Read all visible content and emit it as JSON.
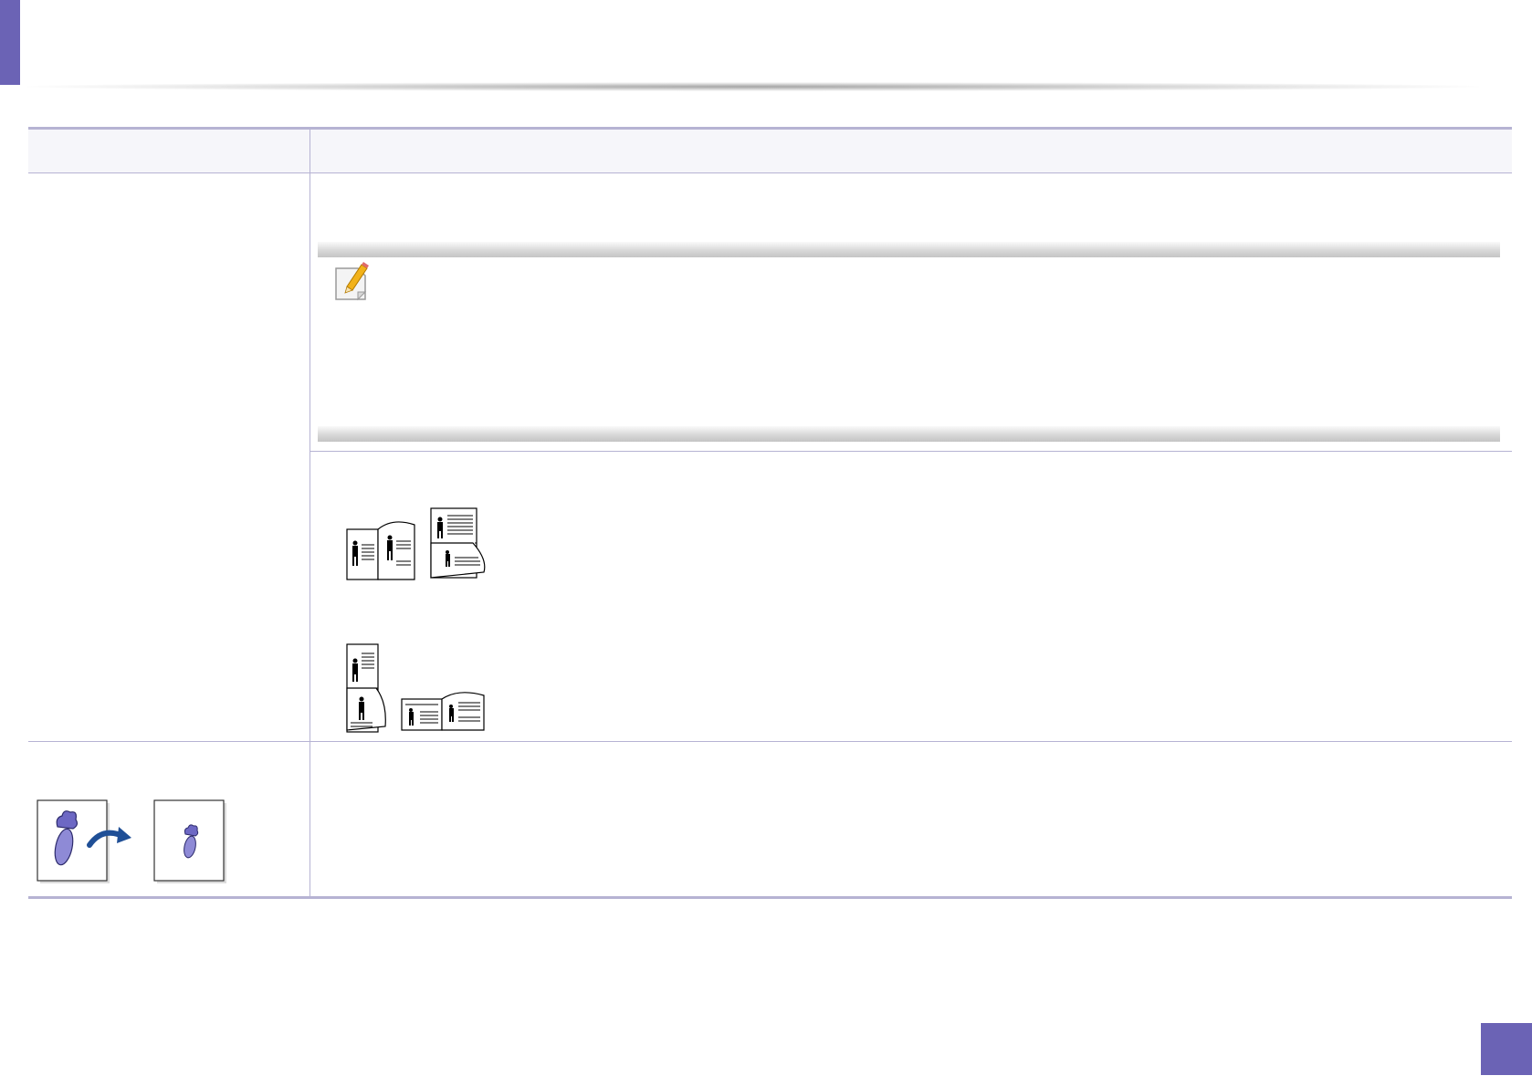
{
  "page": {
    "accent_color": "#6b63b5",
    "rule_color": "#b6b3d3",
    "page_number": ""
  },
  "table": {
    "headers": [
      "",
      ""
    ],
    "rows": [
      {
        "label": "",
        "description": "",
        "note": "",
        "figures": [
          "booklet-binding-illustration-1",
          "booklet-binding-illustration-2"
        ]
      },
      {
        "label": "",
        "description": "",
        "figures": [
          "reduce-image-illustration"
        ]
      }
    ]
  },
  "icons": [
    "note-pencil-icon",
    "curved-arrow-icon"
  ]
}
